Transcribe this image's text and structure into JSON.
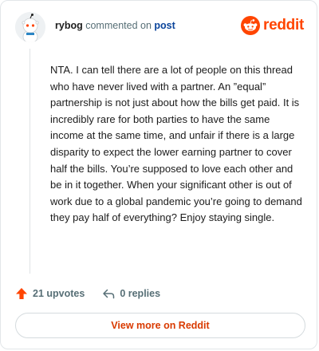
{
  "header": {
    "username": "rybog",
    "action_text": "commented on",
    "post_link": "post",
    "logo_text": "reddit"
  },
  "comment": {
    "body": "NTA. I can tell there are a lot of people on this thread who have never lived with a partner. An ”equal” partnership is not just about how the bills get paid. It is incredibly rare for both parties to have the same income at the same time, and unfair if there is a large disparity to expect the lower earning partner to cover half the bills. You’re supposed to love each other and be in it together. When your significant other is out of work due to a global pandemic you’re going to demand they pay half of everything? Enjoy staying single."
  },
  "actions": {
    "upvotes": "21 upvotes",
    "replies": "0 replies"
  },
  "footer": {
    "view_more": "View more on Reddit"
  },
  "colors": {
    "brand": "#ff4500",
    "upvote": "#ff4500",
    "link": "#0a449b",
    "view_more_text": "#d93a00"
  },
  "icons": {
    "avatar": "snoo-avatar",
    "logo": "reddit-logo-icon",
    "upvote": "upvote-arrow-icon",
    "reply": "reply-arrow-icon"
  }
}
